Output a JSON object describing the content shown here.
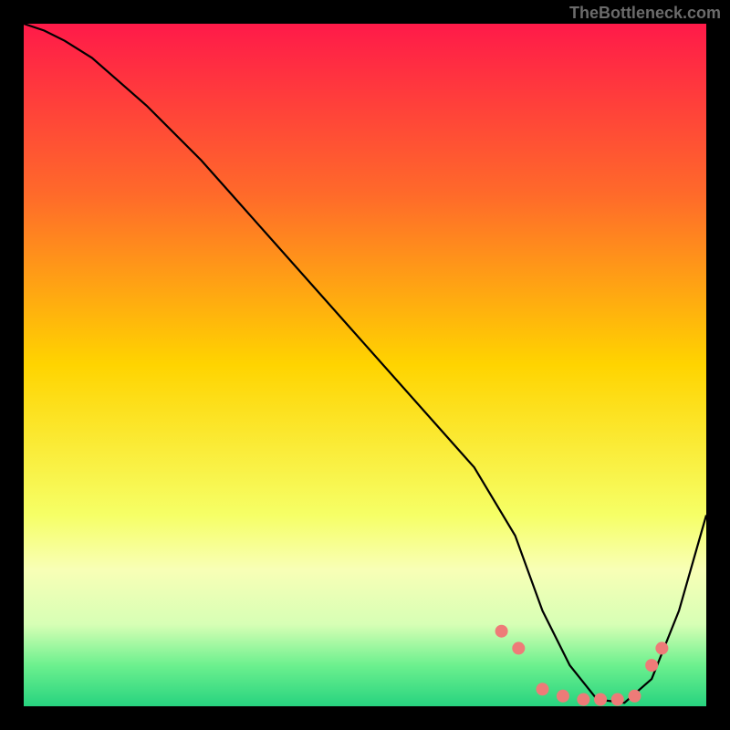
{
  "watermark": "TheBottleneck.com",
  "chart_data": {
    "type": "line",
    "title": "",
    "xlabel": "",
    "ylabel": "",
    "xlim": [
      0,
      100
    ],
    "ylim": [
      0,
      100
    ],
    "gradient": {
      "stops": [
        {
          "pct": 0,
          "color": "#ff1a49"
        },
        {
          "pct": 25,
          "color": "#ff6a2a"
        },
        {
          "pct": 50,
          "color": "#ffd400"
        },
        {
          "pct": 72,
          "color": "#f6ff66"
        },
        {
          "pct": 80,
          "color": "#f8ffb6"
        },
        {
          "pct": 88,
          "color": "#d7ffb5"
        },
        {
          "pct": 94,
          "color": "#6cf08e"
        },
        {
          "pct": 100,
          "color": "#27d37f"
        }
      ]
    },
    "series": [
      {
        "name": "curve",
        "x": [
          0,
          3,
          6,
          10,
          18,
          26,
          34,
          42,
          50,
          58,
          66,
          72,
          76,
          80,
          84,
          88,
          92,
          96,
          100
        ],
        "y": [
          100,
          99,
          97.5,
          95,
          88,
          80,
          71,
          62,
          53,
          44,
          35,
          25,
          14,
          6,
          1,
          0.5,
          4,
          14,
          28
        ]
      }
    ],
    "markers": {
      "name": "dots",
      "color": "#ee7b78",
      "radius_px": 7,
      "x": [
        70,
        72.5,
        76,
        79,
        82,
        84.5,
        87,
        89.5,
        92,
        93.5
      ],
      "y": [
        11,
        8.5,
        2.5,
        1.5,
        1.0,
        1.0,
        1.0,
        1.5,
        6,
        8.5
      ]
    }
  }
}
